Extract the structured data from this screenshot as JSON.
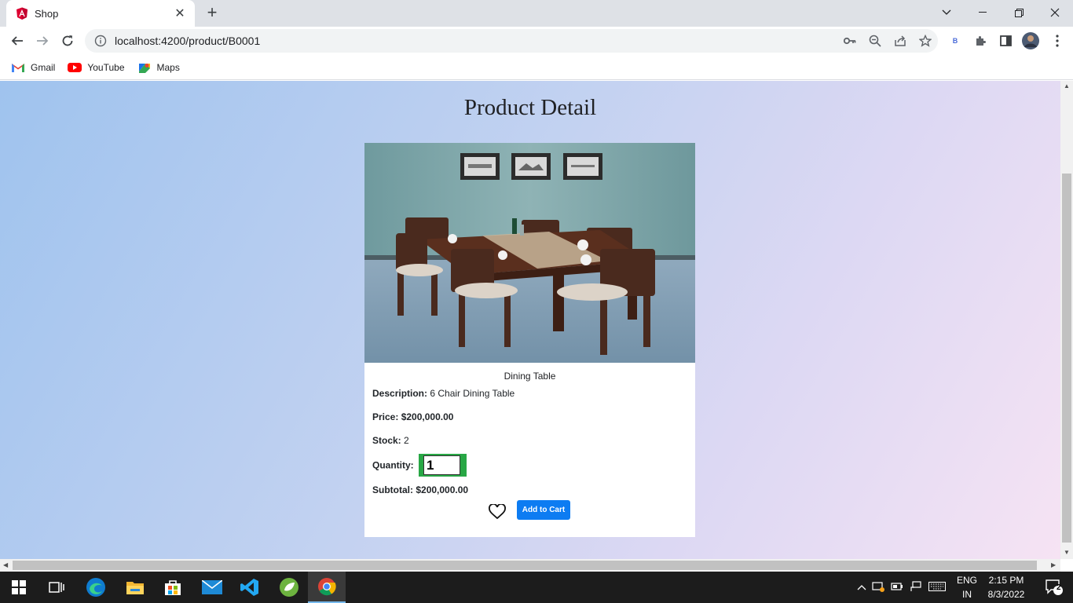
{
  "browser": {
    "tab_title": "Shop",
    "url": "localhost:4200/product/B0001",
    "profile_letter": "B"
  },
  "bookmarks": [
    {
      "label": "Gmail",
      "icon": "gmail-icon"
    },
    {
      "label": "YouTube",
      "icon": "youtube-icon"
    },
    {
      "label": "Maps",
      "icon": "maps-icon"
    }
  ],
  "page": {
    "title": "Product Detail",
    "product": {
      "name": "Dining Table",
      "description_label": "Description:",
      "description": "6 Chair Dining Table",
      "price_label": "Price:",
      "price": "$200,000.00",
      "stock_label": "Stock:",
      "stock": "2",
      "quantity_label": "Quantity:",
      "quantity": "1",
      "subtotal_label": "Subtotal:",
      "subtotal": "$200,000.00"
    },
    "add_to_cart_label": "Add to Cart"
  },
  "taskbar": {
    "lang_top": "ENG",
    "lang_bottom": "IN",
    "time": "2:15 PM",
    "date": "8/3/2022",
    "notification_count": "2"
  },
  "colors": {
    "accent_button": "#0d7cf2",
    "quantity_border": "#28a745"
  }
}
